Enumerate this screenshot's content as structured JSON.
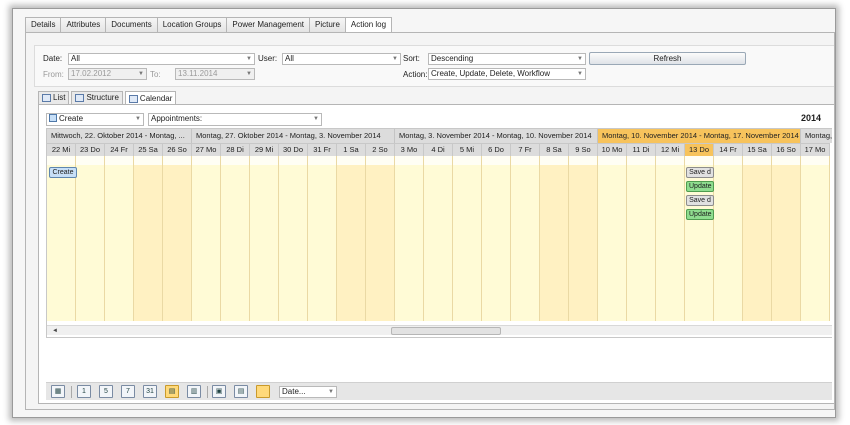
{
  "top_tabs": [
    "Details",
    "Attributes",
    "Documents",
    "Location Groups",
    "Power Management",
    "Picture",
    "Action log"
  ],
  "filters": {
    "date_label": "Date:",
    "date_value": "All",
    "user_label": "User:",
    "user_value": "All",
    "sort_label": "Sort:",
    "sort_value": "Descending",
    "refresh_label": "Refresh",
    "from_label": "From:",
    "from_value": "17.02.2012",
    "to_label": "To:",
    "to_value": "13.11.2014",
    "action_label": "Action:",
    "action_value": "Create, Update, Delete, Workflow"
  },
  "view_tabs": [
    "List",
    "Structure",
    "Calendar"
  ],
  "cal_toolbar": {
    "filter1": "Create",
    "filter2": "Appointments:",
    "year": "2014"
  },
  "weeks": [
    "Mittwoch, 22. Oktober 2014 - Montag, ...",
    "Montag, 27. Oktober 2014 - Montag, 3. November 2014",
    "Montag, 3. November 2014 - Montag, 10. November 2014",
    "Montag, 10. November 2014 - Montag, 17. November 2014",
    "Montag, ..."
  ],
  "days": [
    "22 Mi",
    "23 Do",
    "24 Fr",
    "25 Sa",
    "26 So",
    "27 Mo",
    "28 Di",
    "29 Mi",
    "30 Do",
    "31 Fr",
    "1 Sa",
    "2 So",
    "3 Mo",
    "4 Di",
    "5 Mi",
    "6 Do",
    "7 Fr",
    "8 Sa",
    "9 So",
    "10 Mo",
    "11 Di",
    "12 Mi",
    "13 Do",
    "14 Fr",
    "15 Sa",
    "16 So",
    "17 Mo"
  ],
  "appointments": {
    "create": "Create",
    "save1": "Save d",
    "update1": "Update",
    "save2": "Save d",
    "update2": "Update"
  },
  "bottom": {
    "b1": "1",
    "b2": "5",
    "b3": "7",
    "b4": "31",
    "date_combo": "Date..."
  }
}
